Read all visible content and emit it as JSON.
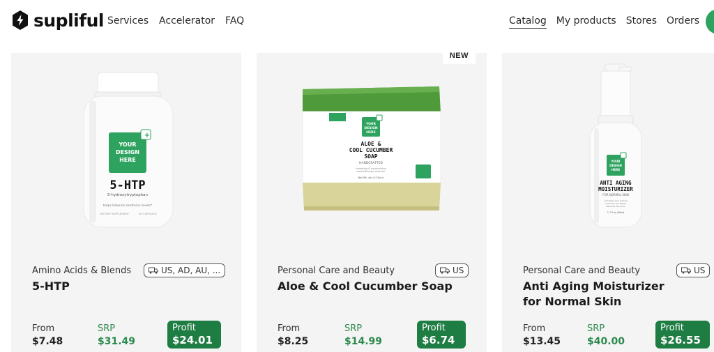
{
  "header": {
    "logo_text": "supliful",
    "nav_left": [
      "Services",
      "Accelerator",
      "FAQ"
    ],
    "nav_right": [
      "Catalog",
      "My products",
      "Stores",
      "Orders"
    ],
    "active_nav": "Catalog",
    "accent_color": "#2ea35f"
  },
  "products": [
    {
      "category": "Amino Acids & Blends",
      "shipping": "US, AD, AU, ...",
      "title": "5-HTP",
      "from_label": "From",
      "from_price": "$7.48",
      "srp_label": "SRP",
      "srp_price": "$31.49",
      "profit_label": "Profit",
      "profit_value": "$24.01",
      "image": {
        "design_text": [
          "YOUR",
          "DESIGN",
          "HERE"
        ],
        "name": "5-HTP",
        "subtitle": "5-hydroxytryptophan",
        "tagline": "helps balance serotonin levels*",
        "footer_left": "DIETARY SUPPLEMENT",
        "footer_right": "60 CAPSULES"
      }
    },
    {
      "badge": "NEW",
      "category": "Personal Care and Beauty",
      "shipping": "US",
      "title": "Aloe & Cool Cucumber Soap",
      "from_label": "From",
      "from_price": "$8.25",
      "srp_label": "SRP",
      "srp_price": "$14.99",
      "profit_label": "Profit",
      "profit_value": "$6.74",
      "image": {
        "design_text": [
          "YOUR",
          "DESIGN",
          "HERE"
        ],
        "name_line1": "ALOE &",
        "name_line2": "COOL CUCUMBER",
        "name_line3": "SOAP",
        "subtitle": "HANDCRAFTED",
        "tagline1": "hydrating & moisturizing",
        "tagline2": "aromatherapy soap bar",
        "weight": "Net Wt. 4oz (113g) e"
      }
    },
    {
      "category": "Personal Care and Beauty",
      "shipping": "US",
      "title": "Anti Aging Moisturizer for Normal Skin",
      "from_label": "From",
      "from_price": "$13.45",
      "srp_label": "SRP",
      "srp_price": "$40.00",
      "profit_label": "Profit",
      "profit_value": "$26.55",
      "image": {
        "design_text": [
          "YOUR",
          "DESIGN",
          "HERE"
        ],
        "name_line1": "ANTI AGING",
        "name_line2": "MOISTURIZER",
        "subtitle": "FOR NORMAL SKIN",
        "tagline1": "smoothes skin texture",
        "tagline2": "hydrates and fights",
        "tagline3": "Reduces fine lines",
        "volume": "1.7 fl oz (50ml)"
      }
    }
  ]
}
